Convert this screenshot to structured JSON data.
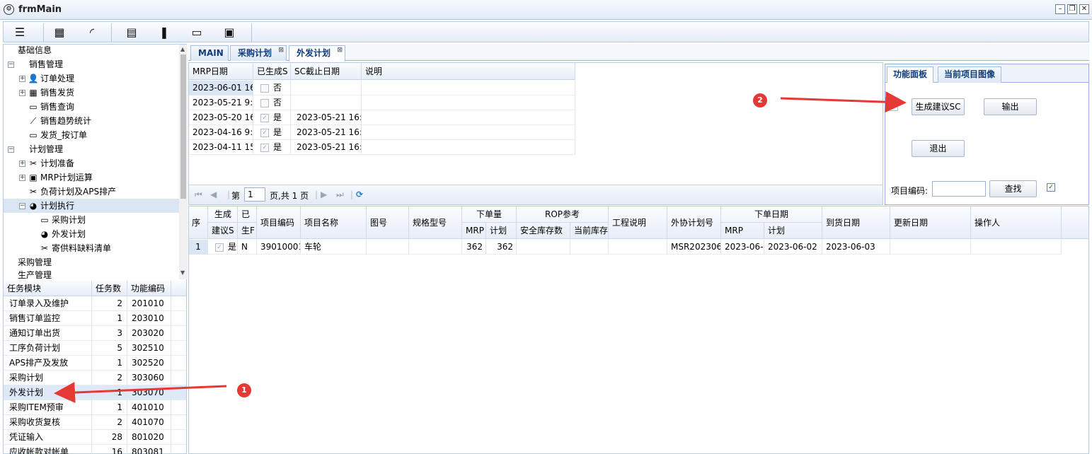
{
  "window": {
    "title": "frmMain"
  },
  "toolbar": {
    "icons": [
      "menu-icon",
      "calculator-icon",
      "rss-icon",
      "calendar-icon",
      "bookmark-icon",
      "inbox-icon",
      "image-icon"
    ]
  },
  "tree": {
    "items": [
      {
        "label": "基础信息"
      },
      {
        "label": "销售管理"
      },
      {
        "label": "订单处理"
      },
      {
        "label": "销售发货"
      },
      {
        "label": "销售查询"
      },
      {
        "label": "销售趋势统计"
      },
      {
        "label": "发货_按订单"
      },
      {
        "label": "计划管理"
      },
      {
        "label": "计划准备"
      },
      {
        "label": "MRP计划运算"
      },
      {
        "label": "负荷计划及APS排产"
      },
      {
        "label": "计划执行"
      },
      {
        "label": "采购计划"
      },
      {
        "label": "外发计划"
      },
      {
        "label": "寄供料缺料清单"
      },
      {
        "label": "采购管理"
      },
      {
        "label": "生产管理"
      }
    ]
  },
  "tasks": {
    "headers": {
      "module": "任务模块",
      "count": "任务数",
      "code": "功能编码"
    },
    "rows": [
      {
        "module": "订单录入及维护",
        "count": "2",
        "code": "201010"
      },
      {
        "module": "销售订单监控",
        "count": "1",
        "code": "203010"
      },
      {
        "module": "通知订单出货",
        "count": "3",
        "code": "203020"
      },
      {
        "module": "工序负荷计划",
        "count": "5",
        "code": "302510"
      },
      {
        "module": "APS排产及发放",
        "count": "1",
        "code": "302520"
      },
      {
        "module": "采购计划",
        "count": "2",
        "code": "303060"
      },
      {
        "module": "外发计划",
        "count": "1",
        "code": "303070"
      },
      {
        "module": "采购ITEM预审",
        "count": "1",
        "code": "401010"
      },
      {
        "module": "采购收货复核",
        "count": "2",
        "code": "401070"
      },
      {
        "module": "凭证输入",
        "count": "28",
        "code": "801020"
      },
      {
        "module": "应收帐款对帐单",
        "count": "16",
        "code": "803081"
      }
    ]
  },
  "tabs": [
    {
      "label": "MAIN"
    },
    {
      "label": "采购计划"
    },
    {
      "label": "外发计划"
    }
  ],
  "mrp": {
    "headers": {
      "date": "MRP日期",
      "generated": "已生成S",
      "deadline": "SC截止日期",
      "desc": "说明"
    },
    "rows": [
      {
        "date": "2023-06-01 16:",
        "generated": "否",
        "deadline": ""
      },
      {
        "date": "2023-05-21 9:5",
        "generated": "否",
        "deadline": ""
      },
      {
        "date": "2023-05-20 16:",
        "generated": "是",
        "deadline": "2023-05-21 16:4"
      },
      {
        "date": "2023-04-16 9:1",
        "generated": "是",
        "deadline": "2023-05-21 16:4"
      },
      {
        "date": "2023-04-11 15:",
        "generated": "是",
        "deadline": "2023-05-21 16:4"
      }
    ]
  },
  "pager": {
    "prefix": "第",
    "page": "1",
    "suffix": "页,共 1 页"
  },
  "panel": {
    "tabs": [
      {
        "label": "功能面板"
      },
      {
        "label": "当前项目图像"
      }
    ],
    "generate_label": "生成建议SC",
    "export_label": "输出",
    "exit_label": "退出",
    "item_code_label": "项目编码:",
    "item_code_value": "",
    "search_label": "查找"
  },
  "detail": {
    "headers": {
      "seq": "序",
      "gen_top": "生成",
      "gen_bottom": "建议S",
      "done_top": "已",
      "done_bottom": "生F",
      "item_code": "项目编码",
      "item_name": "项目名称",
      "drawing": "图号",
      "spec": "规格型号",
      "qty_group": "下单量",
      "qty_mrp": "MRP",
      "qty_plan": "计划",
      "rop_group": "ROP参考",
      "rop_safe": "安全库存数",
      "rop_current": "当前库存",
      "eng_note": "工程说明",
      "out_plan_no": "外协计划号",
      "date_group": "下单日期",
      "date_mrp": "MRP",
      "date_plan": "计划",
      "arrive": "到货日期",
      "update": "更新日期",
      "operator": "操作人"
    },
    "rows": [
      {
        "seq": "1",
        "gen": "是",
        "done": "N",
        "item_code": "39010001",
        "item_name": "车轮",
        "drawing": "",
        "spec": "",
        "qty_mrp": "362",
        "qty_plan": "362",
        "rop_safe": "",
        "rop_current": "",
        "eng_note": "",
        "out_plan_no": "MSR2023060",
        "date_mrp": "2023-06-0",
        "date_plan": "2023-06-02",
        "arrive": "2023-06-03",
        "update": "",
        "operator": ""
      }
    ]
  },
  "annotations": [
    {
      "label": "1"
    },
    {
      "label": "2"
    }
  ],
  "colors": {
    "arrow": "#e53935",
    "accent": "#0e3d7a",
    "selection": "#dbe6f5"
  }
}
